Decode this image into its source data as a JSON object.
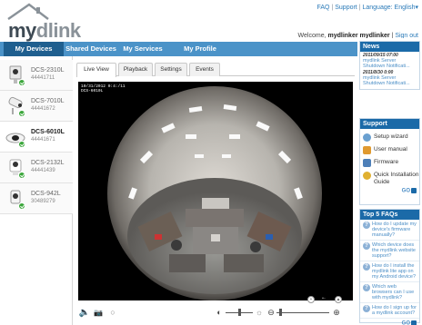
{
  "header": {
    "logo_main": "my",
    "logo_link": "dlink",
    "toplinks": [
      "FAQ",
      "Support",
      "Language: English▾"
    ],
    "welcome_prefix": "Welcome,",
    "username": "mydlinker mydlinker",
    "signout": "Sign out"
  },
  "nav": {
    "items": [
      {
        "label": "My Devices"
      },
      {
        "label": "Shared Devices"
      },
      {
        "label": "My Services"
      },
      {
        "label": "My Profile"
      }
    ]
  },
  "devices": [
    {
      "name": "DCS-2310L",
      "id": "44441711"
    },
    {
      "name": "DCS-7010L",
      "id": "44441672"
    },
    {
      "name": "DCS-6010L",
      "id": "44441671"
    },
    {
      "name": "DCS-2132L",
      "id": "44441439"
    },
    {
      "name": "DCS-942L",
      "id": "30489279"
    }
  ],
  "main": {
    "tabs": [
      {
        "label": "Live View"
      },
      {
        "label": "Playback"
      },
      {
        "label": "Settings"
      },
      {
        "label": "Events"
      }
    ],
    "timestamp_line1": "10/31/2012 0:4:/11",
    "timestamp_line2": "DCS-6010L"
  },
  "news": {
    "title": "News",
    "items": [
      {
        "date": "2011/09/15 07:00",
        "text": "mydlink Server Shutdown Notificati..."
      },
      {
        "date": "2011/8/30 0:00",
        "text": "mydlink Server Shutdown Notificati..."
      }
    ]
  },
  "support": {
    "title": "Support",
    "items": [
      {
        "label": "Setup wizard",
        "icon": "wand-icon"
      },
      {
        "label": "User manual",
        "icon": "book-icon"
      },
      {
        "label": "Firmware",
        "icon": "chip-icon"
      },
      {
        "label": "Quick Installation Guide",
        "icon": "gears-icon"
      }
    ],
    "go": "GO"
  },
  "faqs": {
    "title": "Top 5 FAQs",
    "items": [
      "How do I update my device's firmware manually?",
      "Which device does the mydlink website support?",
      "How do I install the mydlink lite app on my Android device?",
      "Which web browsers can I use with mydlink?",
      "How do I sign up for a mydlink account?"
    ],
    "go": "GO"
  },
  "colors": {
    "nav_bg": "#4b93c8",
    "nav_active": "#1f5f8f",
    "box_head": "#1b6aa8",
    "link": "#4b8ec6",
    "status_ok": "#3aa63a"
  }
}
